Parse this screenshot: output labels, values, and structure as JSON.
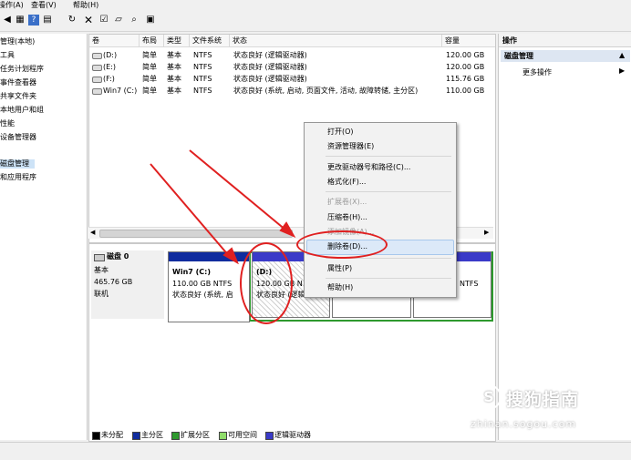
{
  "menu": [
    "操作(A)",
    "查看(V)",
    "帮助(H)"
  ],
  "tree": [
    "管理(本地)",
    "工具",
    "任务计划程序",
    "事件查看器",
    "共享文件夹",
    "本地用户和组",
    "性能",
    "设备管理器",
    "",
    "磁盘管理",
    "和应用程序"
  ],
  "columns": [
    "卷",
    "布局",
    "类型",
    "文件系统",
    "状态",
    "容量"
  ],
  "volumes": [
    {
      "name": "(D:)",
      "layout": "简单",
      "type": "基本",
      "fs": "NTFS",
      "status": "状态良好 (逻辑驱动器)",
      "capacity": "120.00 GB"
    },
    {
      "name": "(E:)",
      "layout": "简单",
      "type": "基本",
      "fs": "NTFS",
      "status": "状态良好 (逻辑驱动器)",
      "capacity": "120.00 GB"
    },
    {
      "name": "(F:)",
      "layout": "简单",
      "type": "基本",
      "fs": "NTFS",
      "status": "状态良好 (逻辑驱动器)",
      "capacity": "115.76 GB"
    },
    {
      "name": "Win7 (C:)",
      "layout": "简单",
      "type": "基本",
      "fs": "NTFS",
      "status": "状态良好 (系统, 启动, 页面文件, 活动, 故障转储, 主分区)",
      "capacity": "110.00 GB"
    }
  ],
  "disk": {
    "name": "磁盘 0",
    "type": "基本",
    "size": "465.76 GB",
    "state": "联机"
  },
  "partitions": [
    {
      "name": "Win7 (C:)",
      "size": "110.00 GB NTFS",
      "status": "状态良好 (系统, 启"
    },
    {
      "name": "(D:)",
      "size": "120.00 GB N",
      "status": "状态良好 (逻辑"
    },
    {
      "name": "",
      "size": "NTFS",
      "status": ""
    }
  ],
  "legend": [
    "未分配",
    "主分区",
    "扩展分区",
    "可用空间",
    "逻辑驱动器"
  ],
  "colors": {
    "unallocated": "#000000",
    "primary": "#102c9e",
    "extended": "#2e9a2e",
    "free": "#8fdc6a",
    "logical": "#3a3ac8"
  },
  "ops": {
    "header": "操作",
    "section": "磁盘管理",
    "more": "更多操作"
  },
  "context_menu": [
    {
      "label": "打开(O)",
      "disabled": false
    },
    {
      "label": "资源管理器(E)",
      "disabled": false
    },
    {
      "label": "更改驱动器号和路径(C)...",
      "disabled": false
    },
    {
      "label": "格式化(F)...",
      "disabled": false
    },
    {
      "label": "扩展卷(X)...",
      "disabled": true
    },
    {
      "label": "压缩卷(H)...",
      "disabled": false
    },
    {
      "label": "添加镜像(A)...",
      "disabled": true
    },
    {
      "label": "删除卷(D)...",
      "disabled": false
    },
    {
      "label": "属性(P)",
      "disabled": false
    },
    {
      "label": "帮助(H)",
      "disabled": false
    }
  ],
  "watermark": {
    "brand": "搜狗指南",
    "url": "zhinan.sogou.com"
  }
}
